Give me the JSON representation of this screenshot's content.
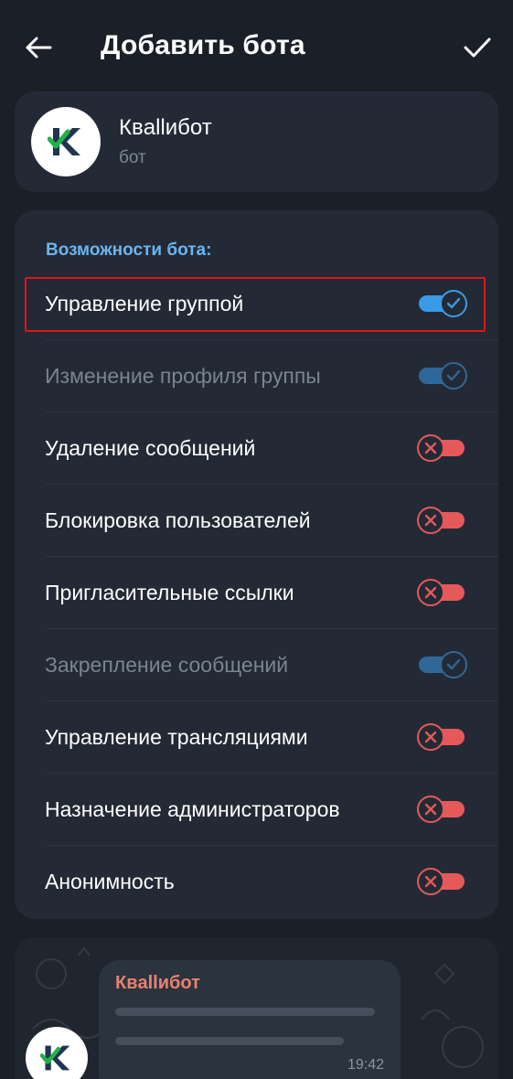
{
  "header": {
    "title": "Добавить бота"
  },
  "bot": {
    "name": "Квallибот",
    "subtitle": "бот"
  },
  "permissions": {
    "section_title": "Возможности бота:",
    "items": [
      {
        "label": "Управление группой",
        "state": "on",
        "enabled": true
      },
      {
        "label": "Изменение профиля группы",
        "state": "on",
        "enabled": false
      },
      {
        "label": "Удаление сообщений",
        "state": "off",
        "enabled": true
      },
      {
        "label": "Блокировка пользователей",
        "state": "off",
        "enabled": true
      },
      {
        "label": "Пригласительные ссылки",
        "state": "off",
        "enabled": true
      },
      {
        "label": "Закрепление сообщений",
        "state": "on",
        "enabled": false
      },
      {
        "label": "Управление трансляциями",
        "state": "off",
        "enabled": true
      },
      {
        "label": "Назначение администраторов",
        "state": "off",
        "enabled": true
      },
      {
        "label": "Анонимность",
        "state": "off",
        "enabled": true
      }
    ]
  },
  "preview": {
    "sender": "Квallибот",
    "time": "19:42"
  },
  "icons": {
    "back": "arrow-left-icon",
    "confirm": "checkmark-icon",
    "logo": "kvallibot-logo-icon"
  },
  "colors": {
    "accent": "#3a9ae6",
    "off": "#e5595a",
    "section": "#6cb4f0",
    "sender": "#e8826c"
  }
}
